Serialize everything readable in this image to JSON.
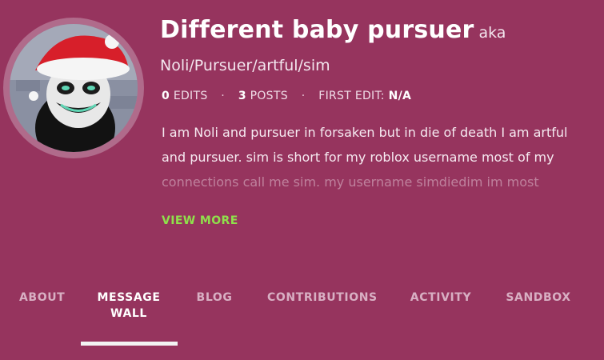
{
  "profile": {
    "username": "Different baby pursuer",
    "aka": "aka Noli/Pursuer/artful/sim",
    "stats": {
      "edits_count": "0",
      "edits_label": "EDITS",
      "posts_count": "3",
      "posts_label": "POSTS",
      "first_edit_label": "FIRST EDIT:",
      "first_edit_value": "N/A",
      "separator": "·"
    },
    "bio_line1": "I am Noli and pursuer in forsaken but in die of death I am artful",
    "bio_line2": "and pursuer. sim is short for my roblox username most of my",
    "bio_line3": "connections call me sim. my username simdiedim im most",
    "view_more": "VIEW MORE"
  },
  "tabs": [
    {
      "label": "ABOUT"
    },
    {
      "label": "MESSAGE WALL",
      "active": true
    },
    {
      "label": "BLOG"
    },
    {
      "label": "CONTRIBUTIONS"
    },
    {
      "label": "ACTIVITY"
    },
    {
      "label": "SANDBOX"
    }
  ],
  "colors": {
    "background": "#96345e",
    "accent_green": "#8fe04b",
    "tab_inactive": "#d8afc3",
    "tab_active": "#ffffff"
  },
  "icons": {
    "avatar": "santa-hat-character-avatar"
  }
}
